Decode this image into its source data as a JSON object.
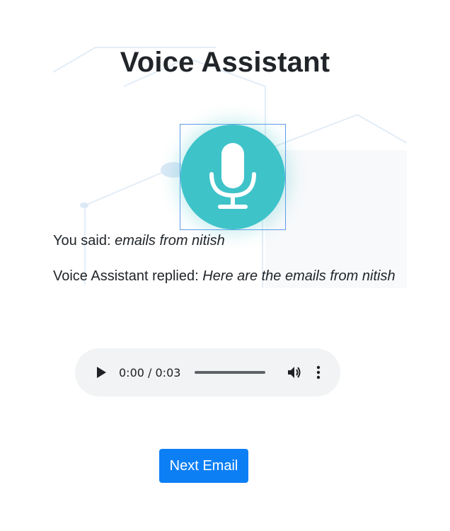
{
  "header": {
    "title": "Voice Assistant"
  },
  "mic": {
    "icon": "microphone-icon",
    "color": "#3ec3c9"
  },
  "conversation": {
    "said_label": "You said:",
    "said_text": "emails from nitish",
    "reply_label": "Voice Assistant replied:",
    "reply_text": "Here are the emails from nitish"
  },
  "audio": {
    "time": "0:00 / 0:03",
    "play_icon": "play-icon",
    "volume_icon": "volume-icon",
    "more_icon": "more-vertical-icon"
  },
  "actions": {
    "next_label": "Next Email",
    "next_color": "#0d7ff5"
  }
}
